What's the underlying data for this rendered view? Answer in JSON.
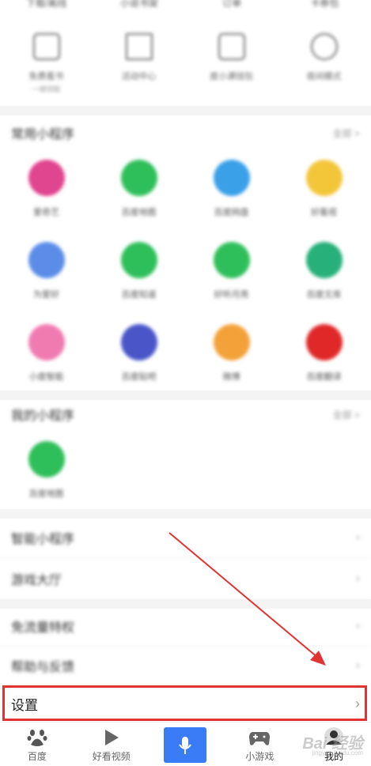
{
  "top_row": [
    "下载/离线",
    "小说书架",
    "订单",
    "卡券包"
  ],
  "tools": [
    {
      "label": "免费看书",
      "sub": "一键领取",
      "icon": "bag-icon"
    },
    {
      "label": "活动中心",
      "sub": "",
      "icon": "flag-icon"
    },
    {
      "label": "度小满钱包",
      "sub": "",
      "icon": "wallet-icon"
    },
    {
      "label": "夜间模式",
      "sub": "",
      "icon": "moon-icon"
    }
  ],
  "common_mini_programs": {
    "title": "常用小程序",
    "more": "全部 >",
    "apps": [
      {
        "label": "爱奇艺",
        "color": "#e0458f"
      },
      {
        "label": "百度地图",
        "color": "#2fbf5a"
      },
      {
        "label": "百度网盘",
        "color": "#3aa0e8"
      },
      {
        "label": "好看视",
        "color": "#f3c63a"
      },
      {
        "label": "为爱好",
        "color": "#5b8de8"
      },
      {
        "label": "百度知道",
        "color": "#2fbf5a"
      },
      {
        "label": "好听月亮",
        "color": "#2fbf5a"
      },
      {
        "label": "百度文库",
        "color": "#27b07a"
      },
      {
        "label": "小度智能",
        "color": "#f07bb0"
      },
      {
        "label": "百度贴吧",
        "color": "#4a56c8"
      },
      {
        "label": "微博",
        "color": "#f3a23a"
      },
      {
        "label": "百度翻译",
        "color": "#e02828"
      }
    ]
  },
  "my_mini_programs": {
    "title": "我的小程序",
    "more": "全部 >",
    "apps": [
      {
        "label": "百度地图",
        "color": "#2fbf5a"
      }
    ]
  },
  "list_items": [
    "智能小程序",
    "游戏大厅",
    "免流量特权",
    "帮助与反馈"
  ],
  "settings": {
    "label": "设置"
  },
  "tabbar": {
    "tabs": [
      {
        "label": "百度",
        "icon": "baidu-paw-icon"
      },
      {
        "label": "好看视频",
        "icon": "play-icon"
      },
      {
        "label": "",
        "icon": "mic-icon"
      },
      {
        "label": "小游戏",
        "icon": "gamepad-icon"
      },
      {
        "label": "我的",
        "icon": "avatar-icon"
      }
    ]
  },
  "watermark": {
    "text": "Bai 经验",
    "sub": "jingyan.baidu.com"
  },
  "colors": {
    "accent": "#3a7cf6",
    "highlight": "#e23333"
  }
}
